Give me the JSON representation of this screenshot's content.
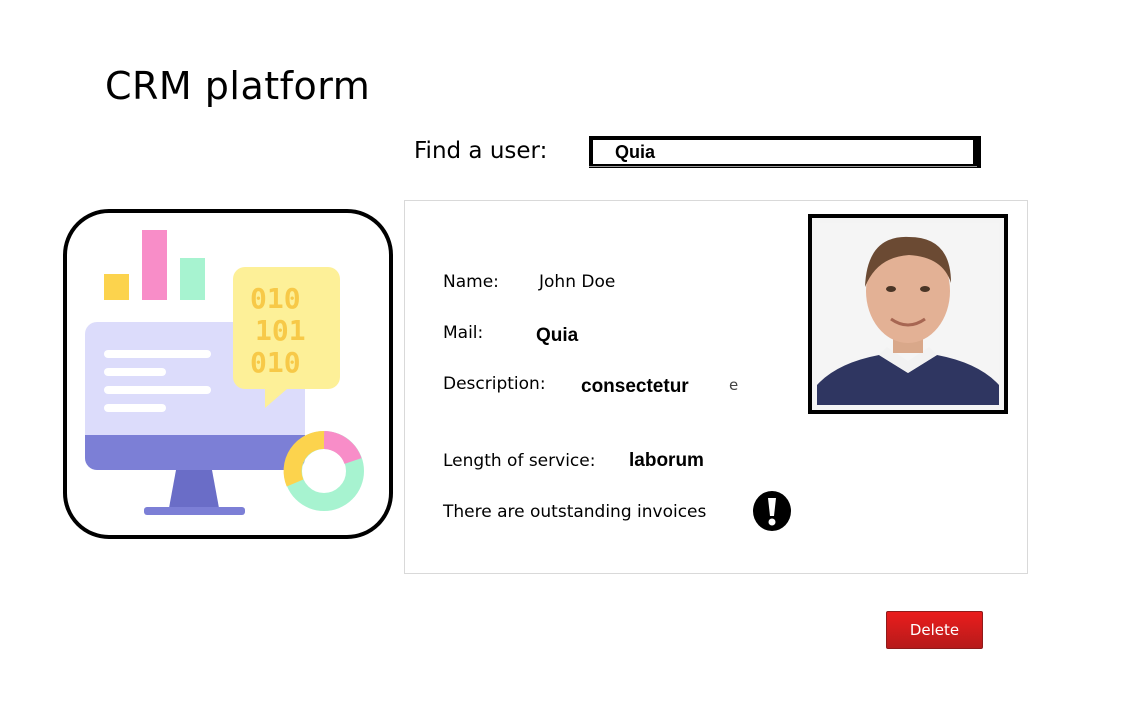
{
  "app": {
    "title": "CRM platform"
  },
  "search": {
    "label": "Find a user:",
    "value": "Quia"
  },
  "profile": {
    "name_label": "Name:",
    "name_value": "John Doe",
    "mail_label": "Mail:",
    "mail_value": "Quia",
    "description_label": "Description:",
    "description_value": "consectetur",
    "description_trailing": "e",
    "service_label": "Length of service:",
    "service_value": "laborum",
    "invoices_text": "There are outstanding invoices",
    "alert_icon": "exclamation-icon"
  },
  "actions": {
    "delete_label": "Delete"
  },
  "colors": {
    "delete_button": "#d81e1e",
    "illustration_bar_yellow": "#fcd34d",
    "illustration_bar_pink": "#f88dc8",
    "illustration_bar_green": "#a7f3d0",
    "illustration_monitor": "#7c7fd6",
    "illustration_screen": "#dcdcfb"
  }
}
